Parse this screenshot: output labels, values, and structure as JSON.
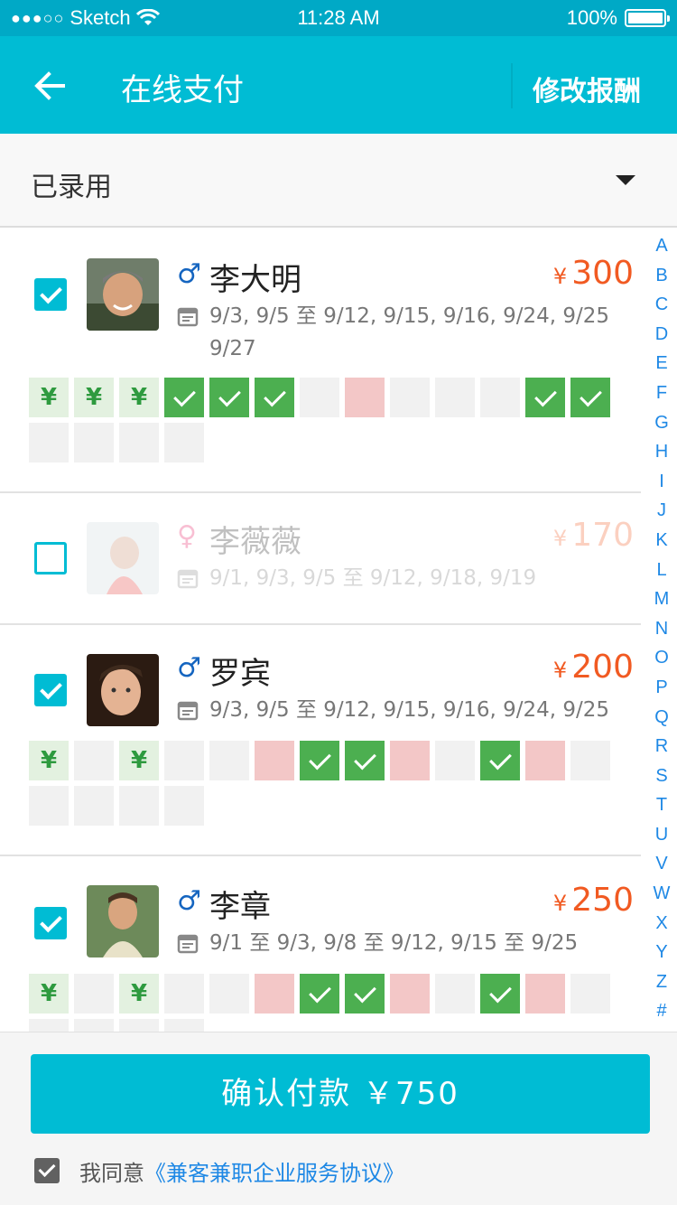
{
  "status": {
    "carrier": "Sketch",
    "time": "11:28 AM",
    "battery": "100%",
    "signal_dots": "●●●○○"
  },
  "nav": {
    "title": "在线支付",
    "action": "修改报酬"
  },
  "filter": {
    "label": "已录用"
  },
  "workers": [
    {
      "name": "李大明",
      "gender": "♂",
      "gender_color": "#1565c0",
      "checked": true,
      "price_symbol": "¥",
      "price": "300",
      "dates": "9/3, 9/5 至 9/12, 9/15, 9/16, 9/24, 9/25 9/27",
      "cells": [
        "yen",
        "yen",
        "yen",
        "green",
        "green",
        "green",
        "empty",
        "pink",
        "empty",
        "empty",
        "empty",
        "green",
        "green",
        "empty",
        "empty",
        "empty",
        "empty"
      ]
    },
    {
      "name": "李薇薇",
      "gender": "♀",
      "gender_color": "#e91e63",
      "checked": false,
      "price_symbol": "¥",
      "price": "170",
      "dates": "9/1, 9/3, 9/5 至 9/12, 9/18, 9/19",
      "cells": []
    },
    {
      "name": "罗宾",
      "gender": "♂",
      "gender_color": "#1565c0",
      "checked": true,
      "price_symbol": "¥",
      "price": "200",
      "dates": "9/3, 9/5 至 9/12, 9/15, 9/16, 9/24, 9/25",
      "cells": [
        "yen",
        "empty",
        "yen",
        "empty",
        "empty",
        "pink",
        "green",
        "green",
        "pink",
        "empty",
        "green",
        "pink",
        "empty",
        "empty",
        "empty",
        "empty",
        "empty"
      ]
    },
    {
      "name": "李章",
      "gender": "♂",
      "gender_color": "#1565c0",
      "checked": true,
      "price_symbol": "¥",
      "price": "250",
      "dates": "9/1 至 9/3, 9/8 至 9/12, 9/15 至 9/25",
      "cells": [
        "yen",
        "empty",
        "yen",
        "empty",
        "empty",
        "pink",
        "green",
        "green",
        "pink",
        "empty",
        "green",
        "pink",
        "empty",
        "empty",
        "empty",
        "empty",
        "empty"
      ]
    }
  ],
  "index_letters": [
    "A",
    "B",
    "C",
    "D",
    "E",
    "F",
    "G",
    "H",
    "I",
    "J",
    "K",
    "L",
    "M",
    "N",
    "O",
    "P",
    "Q",
    "R",
    "S",
    "T",
    "U",
    "V",
    "W",
    "X",
    "Y",
    "Z",
    "#"
  ],
  "footer": {
    "pay_button": "确认付款 ￥750",
    "agree_text": "我同意",
    "agreement_link": "《兼客兼职企业服务协议》"
  },
  "colors": {
    "accent": "#00bcd4",
    "price": "#f15a22",
    "link": "#1e88e5"
  }
}
